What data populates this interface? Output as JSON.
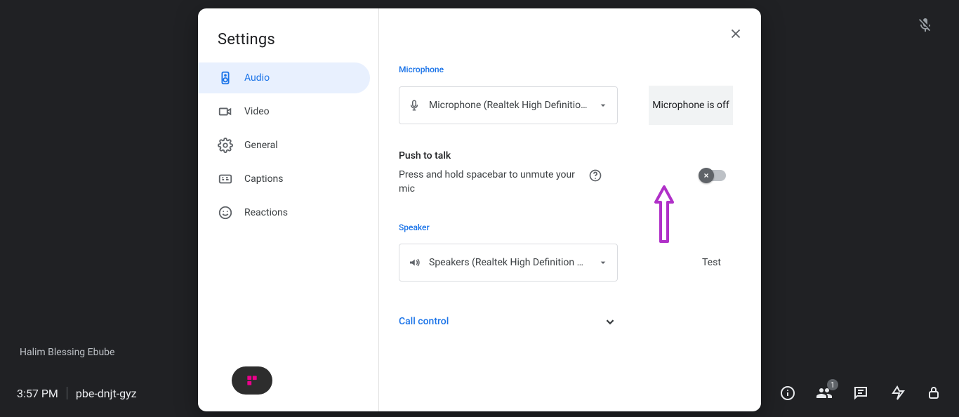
{
  "header": {},
  "participant_name": "Halim Blessing Ebube",
  "bottom": {
    "time": "3:57 PM",
    "meeting_code": "pbe-dnjt-gyz",
    "people_badge": "1"
  },
  "dialog": {
    "title": "Settings",
    "nav": [
      {
        "label": "Audio"
      },
      {
        "label": "Video"
      },
      {
        "label": "General"
      },
      {
        "label": "Captions"
      },
      {
        "label": "Reactions"
      }
    ],
    "audio": {
      "mic_label": "Microphone",
      "mic_device": "Microphone (Realtek High Definitio…",
      "mic_status": "Microphone is off",
      "ptt_title": "Push to talk",
      "ptt_desc": "Press and hold spacebar to unmute your mic",
      "speaker_label": "Speaker",
      "speaker_device": "Speakers (Realtek High Definition A…",
      "test_label": "Test",
      "call_control": "Call control"
    }
  }
}
